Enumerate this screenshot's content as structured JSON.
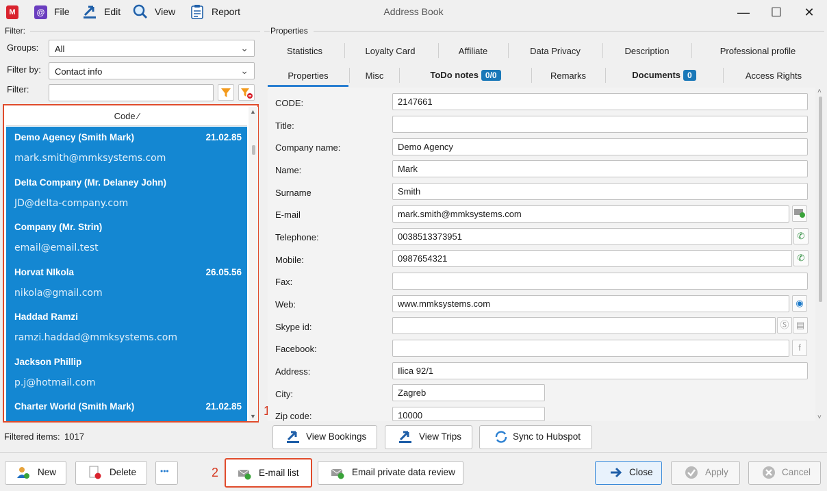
{
  "titlebar": {
    "logo": "M",
    "at": "@",
    "menu": [
      {
        "label": "File",
        "icon": "mail-at-icon"
      },
      {
        "label": "Edit",
        "icon": "edit-arrow-icon"
      },
      {
        "label": "View",
        "icon": "magnifier-icon"
      },
      {
        "label": "Report",
        "icon": "clipboard-icon"
      }
    ],
    "title": "Address Book",
    "minimize": "—",
    "maximize": "☐",
    "close": "✕"
  },
  "filter_panel": {
    "heading": "Filter:",
    "groups_label": "Groups:",
    "groups_value": "All",
    "filterby_label": "Filter by:",
    "filterby_value": "Contact info",
    "filter_label": "Filter:",
    "filter_value": ""
  },
  "list": {
    "column_header": "Code ⁄",
    "items": [
      {
        "name": "Demo Agency (Smith Mark)",
        "date": "21.02.85",
        "email": "mark.smith@mmksystems.com"
      },
      {
        "name": "Delta Company (Mr. Delaney John)",
        "date": "",
        "email": "JD@delta-company.com"
      },
      {
        "name": "Company (Mr. Strin)",
        "date": "",
        "email": "email@email.test"
      },
      {
        "name": "Horvat NIkola",
        "date": "26.05.56",
        "email": "nikola@gmail.com"
      },
      {
        "name": "Haddad Ramzi",
        "date": "",
        "email": "ramzi.haddad@mmksystems.com"
      },
      {
        "name": "Jackson Phillip",
        "date": "",
        "email": "p.j@hotmail.com"
      },
      {
        "name": "Charter World (Smith Mark)",
        "date": "21.02.85",
        "email": ""
      }
    ],
    "callout_1": "1",
    "filtered_items_label": "Filtered items:",
    "filtered_items_count": "1017"
  },
  "properties": {
    "group_title": "Properties",
    "tabs_row1": [
      "Statistics",
      "Loyalty Card",
      "Affiliate",
      "Data Privacy",
      "Description",
      "Professional profile"
    ],
    "tabs_row2": {
      "properties": "Properties",
      "misc": "Misc",
      "todo": "ToDo notes",
      "todo_badge": "0/0",
      "remarks": "Remarks",
      "documents": "Documents",
      "documents_badge": "0",
      "access": "Access Rights"
    },
    "fields": [
      {
        "label": "CODE:",
        "value": "2147661"
      },
      {
        "label": "Title:",
        "value": ""
      },
      {
        "label": "Company name:",
        "value": "Demo Agency"
      },
      {
        "label": "Name:",
        "value": "Mark"
      },
      {
        "label": "Surname",
        "value": "Smith"
      },
      {
        "label": "E-mail",
        "value": "mark.smith@mmksystems.com"
      },
      {
        "label": "Telephone:",
        "value": "0038513373951"
      },
      {
        "label": "Mobile:",
        "value": "0987654321"
      },
      {
        "label": "Fax:",
        "value": ""
      },
      {
        "label": "Web:",
        "value": "www.mmksystems.com"
      },
      {
        "label": "Skype id:",
        "value": ""
      },
      {
        "label": "Facebook:",
        "value": ""
      },
      {
        "label": "Address:",
        "value": "Ilica 92/1"
      },
      {
        "label": "City:",
        "value": "Zagreb"
      },
      {
        "label": "Zip code:",
        "value": "10000"
      }
    ],
    "actions": [
      "View Bookings",
      "View Trips",
      "Sync to Hubspot"
    ]
  },
  "footer": {
    "new": "New",
    "delete": "Delete",
    "more": "•••",
    "callout_2": "2",
    "email_list": "E-mail list",
    "email_private": "Email private data review",
    "close": "Close",
    "apply": "Apply",
    "cancel": "Cancel"
  },
  "colors": {
    "selection": "#1487d2",
    "highlight": "#e04b2b",
    "accent": "#2a7fd1",
    "badge": "#1a78b8"
  }
}
